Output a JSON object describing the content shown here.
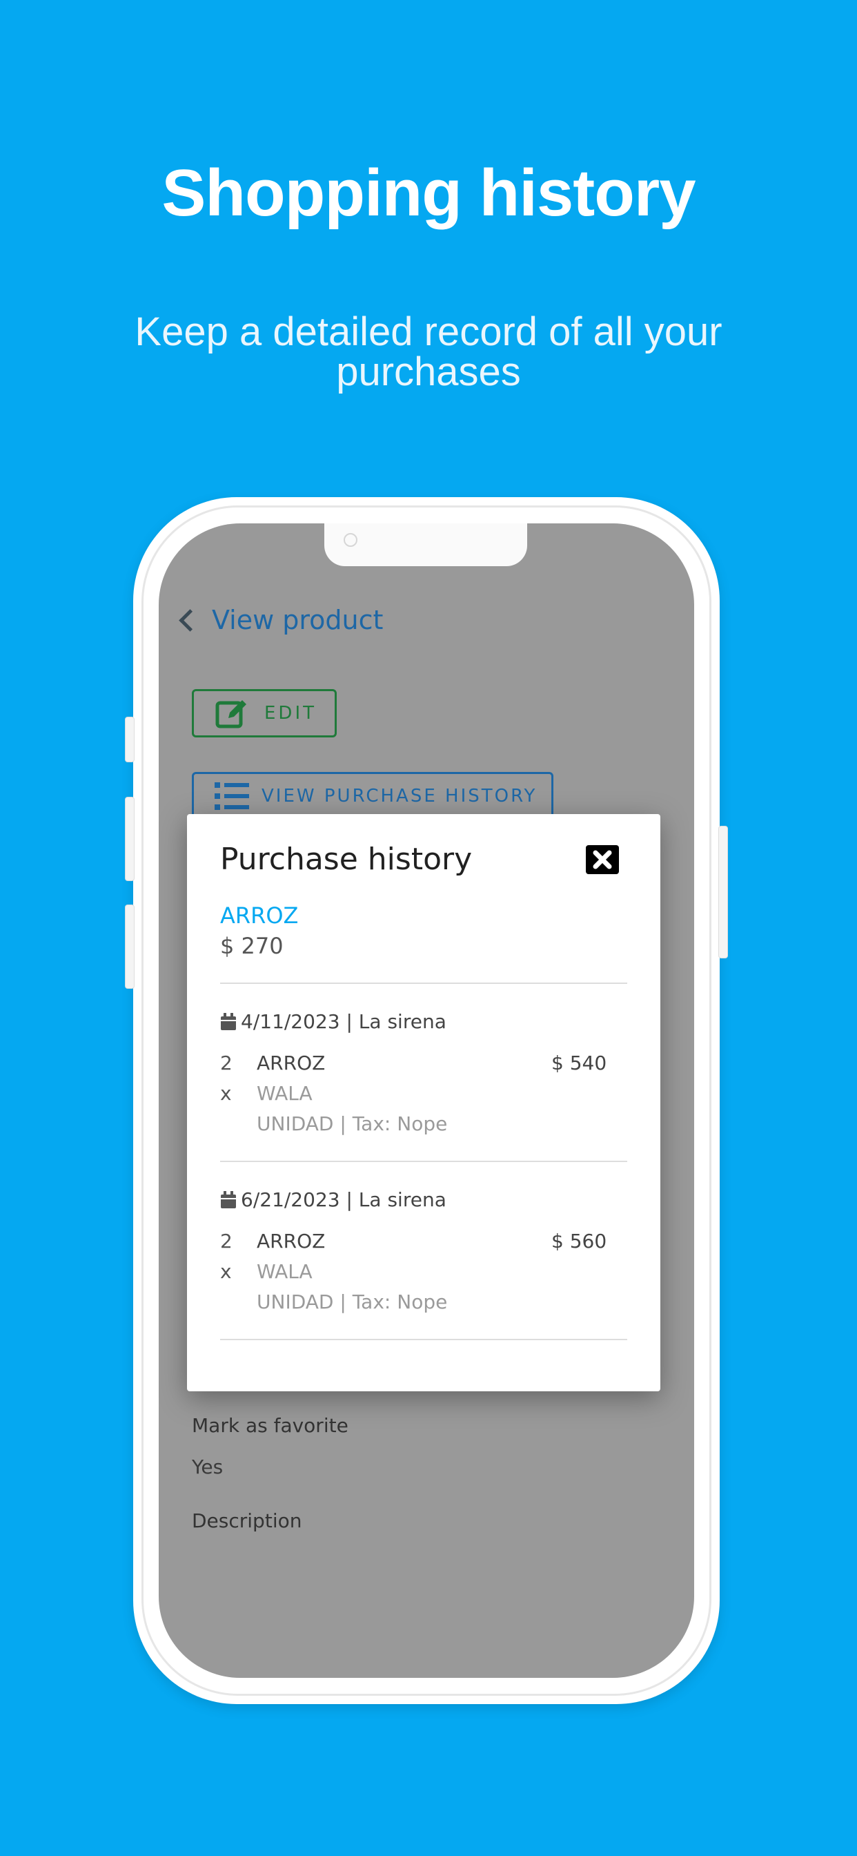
{
  "promo": {
    "title": "Shopping history",
    "subtitle": "Keep a detailed record of all your purchases"
  },
  "app": {
    "back_label": "View product",
    "edit_label": "EDIT",
    "view_history_label": "VIEW PURCHASE HISTORY",
    "favorite_label": "Mark as favorite",
    "favorite_value": "Yes",
    "description_label": "Description"
  },
  "modal": {
    "title": "Purchase history",
    "product_name": "ARROZ",
    "product_price": "$ 270",
    "entries": [
      {
        "date_store": "4/11/2023 | La sirena",
        "quantity": "2",
        "x": "x",
        "item": "ARROZ",
        "brand": "WALA",
        "unit_tax": "UNIDAD | Tax: Nope",
        "total": "$ 540"
      },
      {
        "date_store": "6/21/2023 | La sirena",
        "quantity": "2",
        "x": "x",
        "item": "ARROZ",
        "brand": "WALA",
        "unit_tax": "UNIDAD | Tax: Nope",
        "total": "$ 560"
      }
    ]
  },
  "colors": {
    "background": "#05a8f1",
    "accent_blue": "#1d67a6",
    "accent_green": "#1f7a3a",
    "dim_overlay": "#999999"
  },
  "icons": {
    "back": "chevron-left-icon",
    "edit": "edit-icon",
    "history": "list-icon",
    "close": "close-icon",
    "calendar": "calendar-icon"
  }
}
